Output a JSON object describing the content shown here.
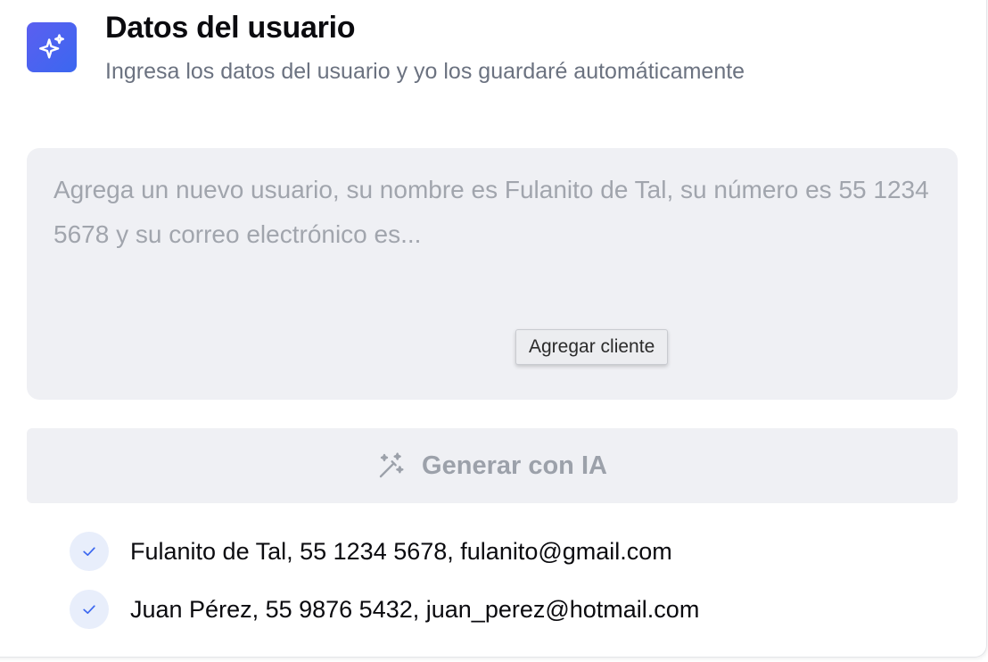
{
  "header": {
    "title": "Datos del usuario",
    "subtitle": "Ingresa los datos del usuario y yo los guardaré automáticamente",
    "icon": "sparkles-icon",
    "icon_gradient": [
      "#5b5ff0",
      "#3b67f0"
    ]
  },
  "input": {
    "placeholder": "Agrega un nuevo usuario, su nombre es Fulanito de Tal, su número es 55 1234 5678 y su correo electrónico es...",
    "value": ""
  },
  "tooltip": {
    "text": "Agregar cliente"
  },
  "generate_button": {
    "label": "Generar con IA",
    "icon": "magic-wand-icon",
    "disabled": true
  },
  "users": [
    {
      "text": "Fulanito de Tal, 55 1234 5678, fulanito@gmail.com",
      "status_icon": "check-icon"
    },
    {
      "text": "Juan Pérez, 55 9876 5432, juan_perez@hotmail.com",
      "status_icon": "check-icon"
    }
  ],
  "colors": {
    "accent": "#3b67f0",
    "panel_bg": "#eff0f4",
    "check_bg": "#e8eefb",
    "muted_text": "#9ca1aa"
  }
}
